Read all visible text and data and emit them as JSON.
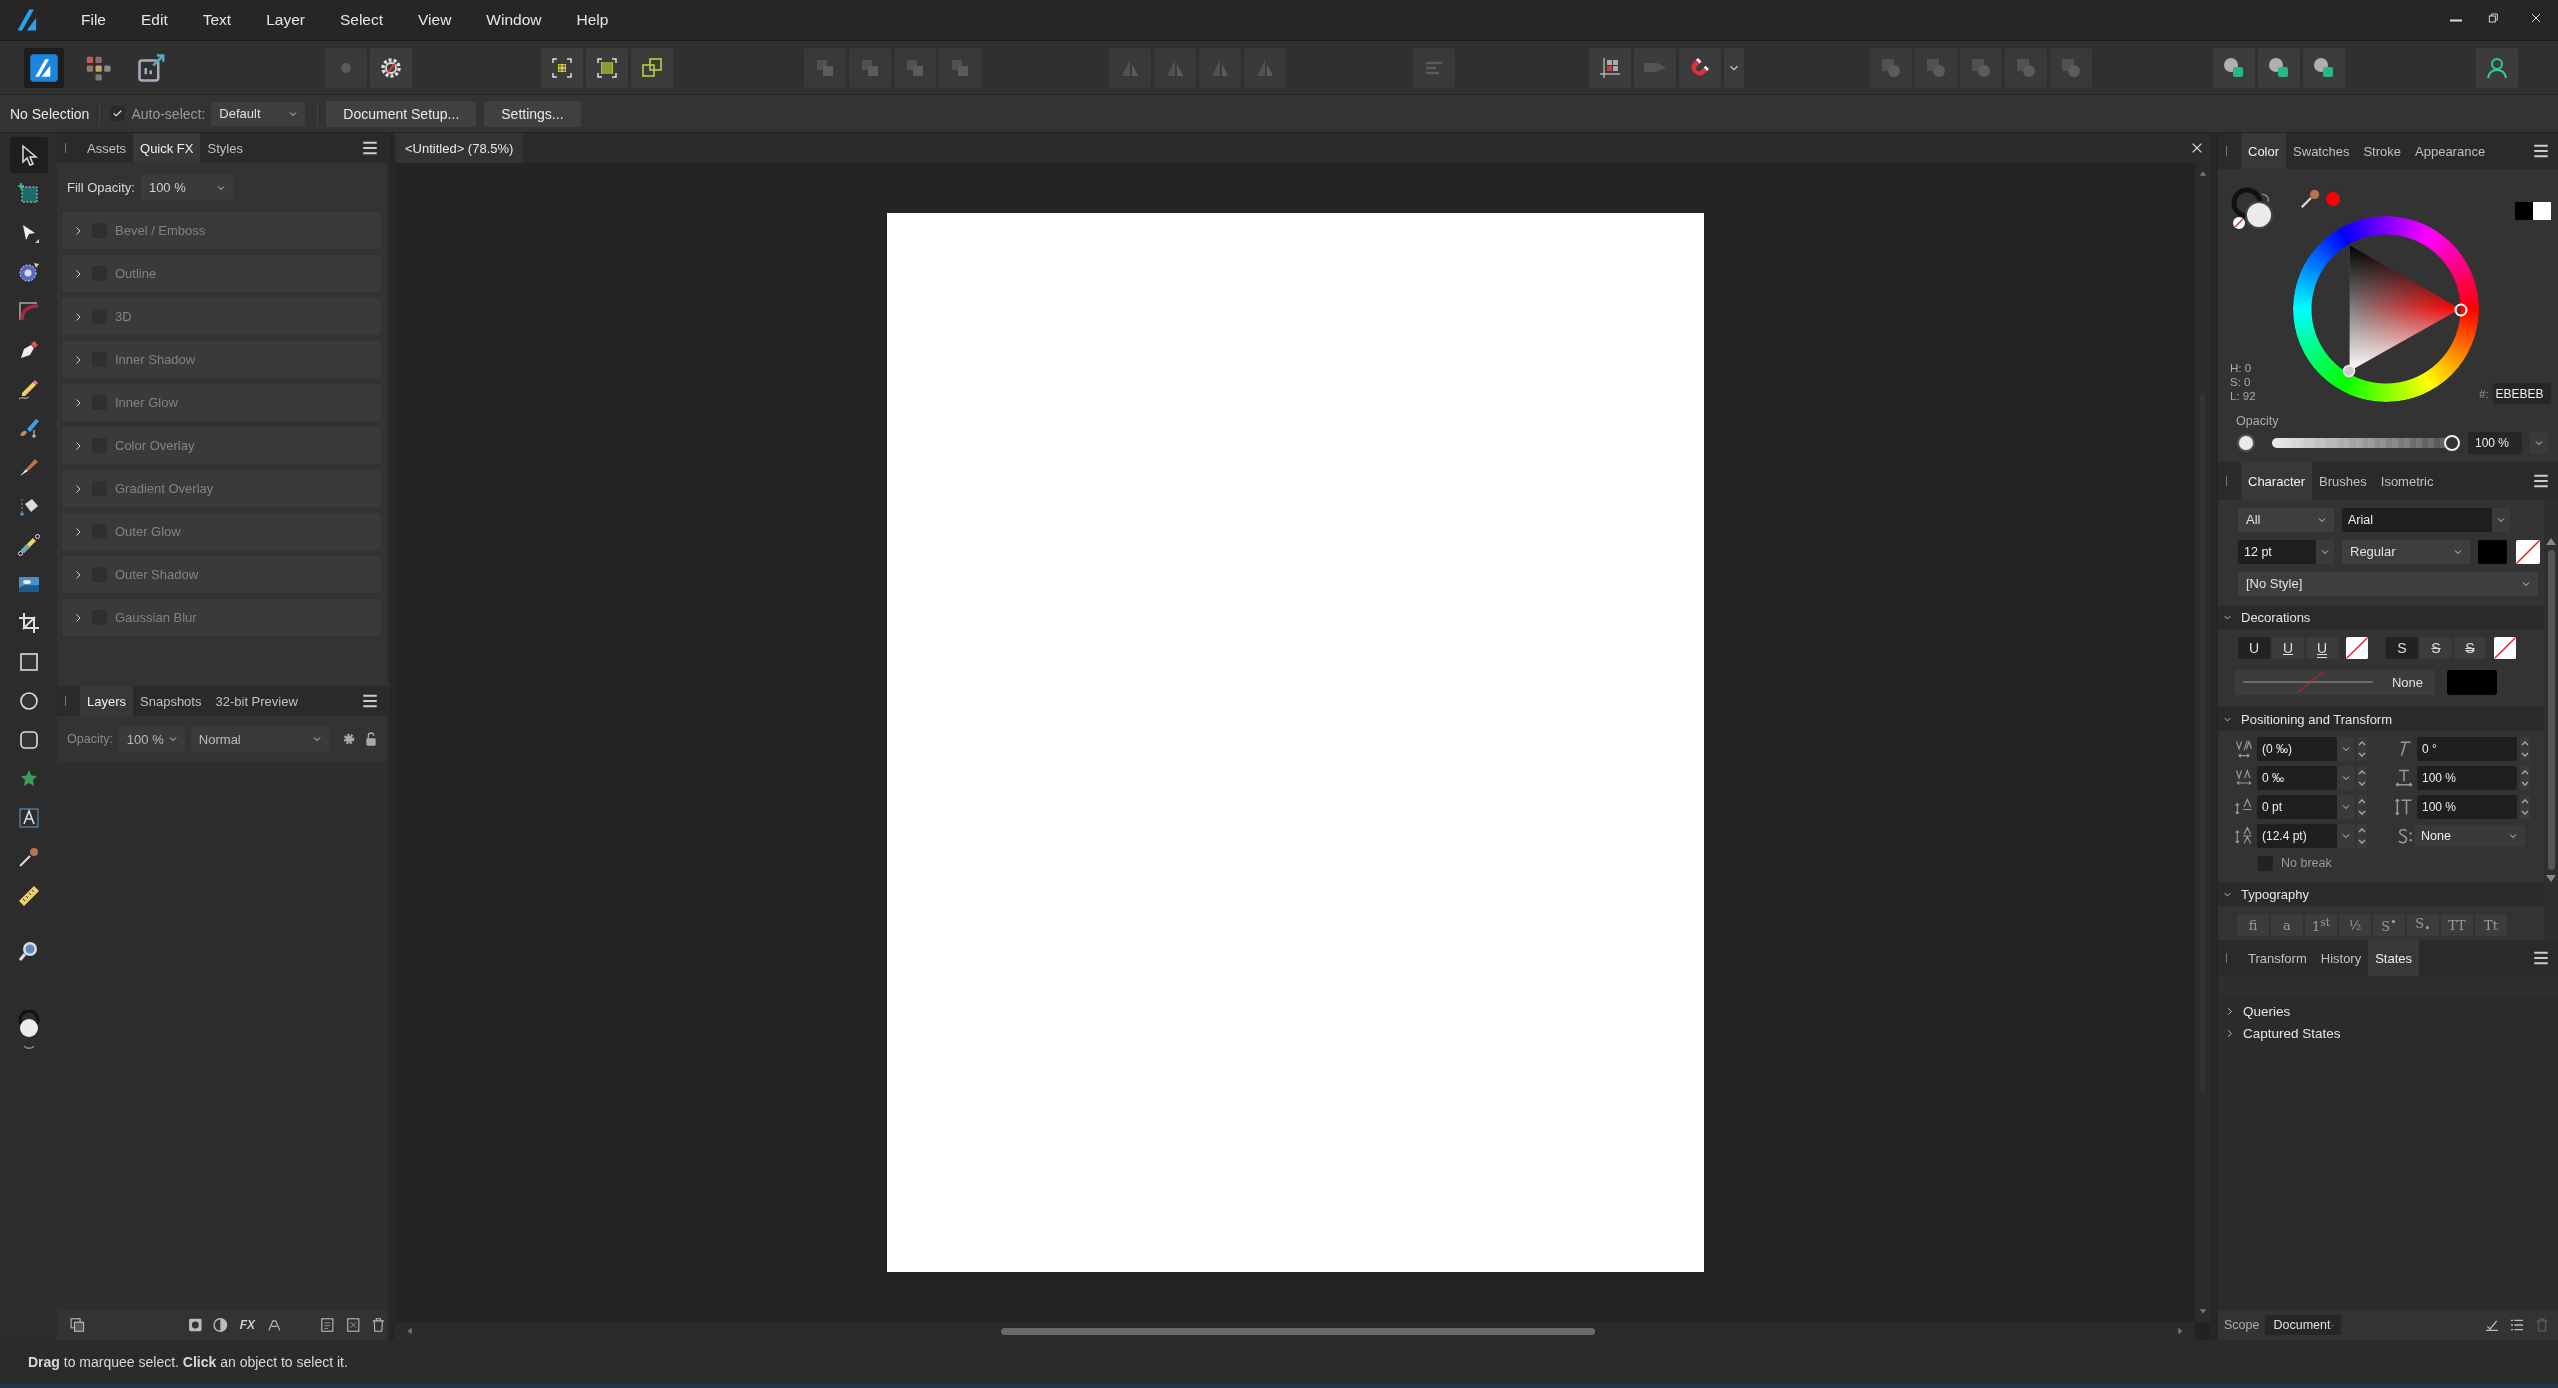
{
  "menu_bar": {
    "items": [
      "File",
      "Edit",
      "Text",
      "Layer",
      "Select",
      "View",
      "Window",
      "Help"
    ]
  },
  "toolbar": {
    "groups": [
      [
        {
          "kind": "persona-designer",
          "selected": true
        },
        {
          "kind": "persona-pixel",
          "selected": false
        },
        {
          "kind": "persona-export",
          "selected": false
        }
      ],
      [
        {
          "kind": "view-mode",
          "disabled": true
        },
        {
          "kind": "gear",
          "disabled": false
        }
      ],
      [
        {
          "kind": "select-all",
          "disabled": false
        },
        {
          "kind": "select-grid",
          "disabled": false
        },
        {
          "kind": "transform-origin",
          "disabled": false
        }
      ],
      [
        {
          "kind": "arrange",
          "disabled": true
        },
        {
          "kind": "arrange",
          "disabled": true
        },
        {
          "kind": "arrange",
          "disabled": true
        },
        {
          "kind": "arrange",
          "disabled": true
        }
      ],
      [
        {
          "kind": "flip",
          "disabled": true
        },
        {
          "kind": "flip",
          "disabled": true
        },
        {
          "kind": "flip",
          "disabled": true
        },
        {
          "kind": "flip",
          "disabled": true
        }
      ],
      [
        {
          "kind": "align",
          "disabled": true
        }
      ],
      [
        {
          "kind": "guides",
          "disabled": false
        },
        {
          "kind": "toggle",
          "disabled": false
        },
        {
          "kind": "snapping",
          "disabled": false
        },
        {
          "kind": "dropdown",
          "disabled": false
        }
      ],
      [
        {
          "kind": "boolean",
          "disabled": true
        },
        {
          "kind": "boolean",
          "disabled": true
        },
        {
          "kind": "boolean",
          "disabled": true
        },
        {
          "kind": "boolean",
          "disabled": true
        },
        {
          "kind": "boolean",
          "disabled": true
        }
      ],
      [
        {
          "kind": "insert",
          "disabled": false
        },
        {
          "kind": "insert",
          "disabled": false
        },
        {
          "kind": "insert",
          "disabled": false
        }
      ],
      [
        {
          "kind": "user",
          "disabled": false
        }
      ]
    ]
  },
  "context_bar": {
    "selection": "No Selection",
    "auto_select": {
      "label": "Auto-select:",
      "checked": true,
      "value": "Default"
    },
    "buttons": [
      "Document Setup...",
      "Settings..."
    ]
  },
  "tools": [
    {
      "kind": "move",
      "selected": true
    },
    {
      "kind": "artboard",
      "selected": false
    },
    {
      "kind": "node",
      "selected": false
    },
    {
      "kind": "contour",
      "selected": false
    },
    {
      "kind": "corner",
      "selected": false
    },
    {
      "kind": "pen",
      "selected": false
    },
    {
      "kind": "pencil",
      "selected": false
    },
    {
      "kind": "vector-brush",
      "selected": false
    },
    {
      "kind": "paint-brush",
      "selected": false
    },
    {
      "kind": "fill",
      "selected": false
    },
    {
      "kind": "gradient",
      "selected": false
    },
    {
      "kind": "place-image",
      "selected": false
    },
    {
      "kind": "crop",
      "selected": false
    },
    {
      "kind": "rectangle",
      "selected": false
    },
    {
      "kind": "ellipse",
      "selected": false
    },
    {
      "kind": "rounded-rectangle",
      "selected": false
    },
    {
      "kind": "shape",
      "selected": false
    },
    {
      "kind": "text",
      "selected": false
    },
    {
      "kind": "color-picker",
      "selected": false
    },
    {
      "kind": "measure",
      "selected": false
    },
    {
      "kind": "zoom",
      "selected": false
    }
  ],
  "left_panel": {
    "tabs": [
      {
        "label": "Assets",
        "selected": false
      },
      {
        "label": "Quick FX",
        "selected": true
      },
      {
        "label": "Styles",
        "selected": false
      }
    ],
    "fill_opacity": {
      "label": "Fill Opacity:",
      "value": "100 %"
    },
    "effects": [
      {
        "label": "Bevel / Emboss",
        "checked": false,
        "expanded": false
      },
      {
        "label": "Outline",
        "checked": false,
        "expanded": false
      },
      {
        "label": "3D",
        "checked": false,
        "expanded": false
      },
      {
        "label": "Inner Shadow",
        "checked": false,
        "expanded": false
      },
      {
        "label": "Inner Glow",
        "checked": false,
        "expanded": false
      },
      {
        "label": "Color Overlay",
        "checked": false,
        "expanded": false
      },
      {
        "label": "Gradient Overlay",
        "checked": false,
        "expanded": false
      },
      {
        "label": "Outer Glow",
        "checked": false,
        "expanded": false
      },
      {
        "label": "Outer Shadow",
        "checked": false,
        "expanded": false
      },
      {
        "label": "Gaussian Blur",
        "checked": false,
        "expanded": false
      }
    ]
  },
  "layers_panel": {
    "tabs": [
      {
        "label": "Layers",
        "selected": true
      },
      {
        "label": "Snapshots",
        "selected": false
      },
      {
        "label": "32-bit Preview",
        "selected": false
      }
    ],
    "opacity": {
      "label": "Opacity:",
      "value": "100 %"
    },
    "blend_mode": "Normal",
    "fx_button": "FX"
  },
  "document": {
    "tab": "<Untitled> (78.5%)"
  },
  "color_panel": {
    "tabs": [
      {
        "label": "Color",
        "selected": true
      },
      {
        "label": "Swatches",
        "selected": false
      },
      {
        "label": "Stroke",
        "selected": false
      },
      {
        "label": "Appearance",
        "selected": false
      }
    ],
    "readings": [
      "H: 0",
      "S: 0",
      "L: 92"
    ],
    "hex_label": "#:",
    "hex": "EBEBEB",
    "opacity_label": "Opacity",
    "opacity": {
      "level": 1,
      "reading": "100 %"
    }
  },
  "character_panel": {
    "tabs": [
      {
        "label": "Character",
        "selected": true
      },
      {
        "label": "Brushes",
        "selected": false
      },
      {
        "label": "Isometric",
        "selected": false
      }
    ],
    "scope": "All",
    "font": "Arial",
    "size": "12 pt",
    "weight": "Regular",
    "style": "[No Style]",
    "decorations": {
      "title": "Decorations",
      "expanded": true,
      "underline": [
        {
          "label": "U",
          "kind": "plain",
          "selected": true
        },
        {
          "label": "U",
          "kind": "single",
          "selected": false
        },
        {
          "label": "U",
          "kind": "double",
          "selected": false
        }
      ],
      "strike": [
        {
          "label": "S",
          "kind": "plain",
          "selected": true
        },
        {
          "label": "S",
          "kind": "single",
          "selected": false
        },
        {
          "label": "S",
          "kind": "double",
          "selected": false
        }
      ],
      "line": "None"
    },
    "positioning": {
      "title": "Positioning and Transform",
      "expanded": true,
      "left_fields": [
        "(0 ‰)",
        "0 ‰",
        "0 pt",
        "(12.4 pt)"
      ],
      "right_fields": [
        {
          "kind": "spin",
          "value": "0 °"
        },
        {
          "kind": "spin",
          "value": "100 %"
        },
        {
          "kind": "spin",
          "value": "100 %"
        },
        {
          "kind": "select",
          "value": "None"
        }
      ],
      "no_break": {
        "label": "No break",
        "checked": false
      }
    },
    "typography": {
      "title": "Typography",
      "expanded": true,
      "buttons": [
        {
          "label": "fi",
          "disabled": true
        },
        {
          "label": "a",
          "disabled": true
        },
        {
          "label": "1$^{st}$",
          "disabled": true
        },
        {
          "label": "½",
          "disabled": true
        },
        {
          "label": "S$^{•}$",
          "disabled": true
        },
        {
          "label": "S$_{•}$",
          "disabled": true
        },
        {
          "label": "TT",
          "disabled": true
        },
        {
          "label": "Tt",
          "disabled": true
        }
      ]
    }
  },
  "states_panel": {
    "tabs": [
      {
        "label": "Transform",
        "selected": false
      },
      {
        "label": "History",
        "selected": false
      },
      {
        "label": "States",
        "selected": true
      }
    ],
    "items": [
      {
        "label": "Queries",
        "expanded": false
      },
      {
        "label": "Captured States",
        "expanded": false
      }
    ],
    "scope_label": "Scope",
    "scope": "Document"
  },
  "status_bar": {
    "text": "**Drag** to marquee select. **Click** an object to select it."
  }
}
